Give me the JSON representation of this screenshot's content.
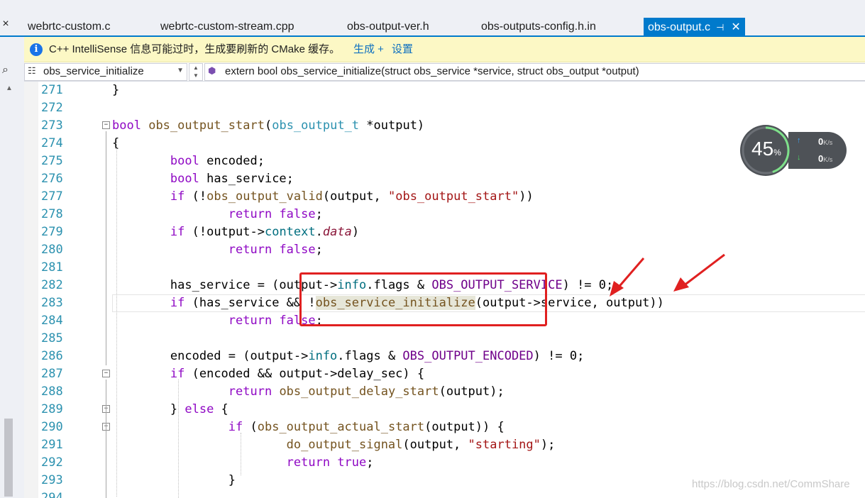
{
  "tabs": {
    "items": [
      {
        "label": "webrtc-custom.c"
      },
      {
        "label": "webrtc-custom-stream.cpp"
      },
      {
        "label": "obs-output-ver.h"
      },
      {
        "label": "obs-outputs-config.h.in"
      },
      {
        "label": "obs-output.c",
        "active": true
      }
    ],
    "close_all": "×",
    "pin_glyph": "⊣",
    "close_glyph": "✕"
  },
  "infobar": {
    "message": "C++ IntelliSense 信息可能过时，生成要刷新的 CMake 缓存。",
    "link_build": "生成 +",
    "link_settings": "设置",
    "icon": "info-icon"
  },
  "navbar": {
    "scope": "obs_service_initialize",
    "member": "extern bool obs_service_initialize(struct obs_service *service, struct obs_output *output)"
  },
  "code": {
    "line_numbers": [
      "271",
      "272",
      "273",
      "274",
      "275",
      "276",
      "277",
      "278",
      "279",
      "280",
      "281",
      "282",
      "283",
      "284",
      "285",
      "286",
      "287",
      "288",
      "289",
      "290",
      "291",
      "292",
      "293",
      "294"
    ]
  },
  "net_widget": {
    "cpu_percent": "45",
    "percent_sign": "%",
    "up_value": "0",
    "down_value": "0",
    "unit": "K/s"
  },
  "watermark": "https://blog.csdn.net/CommShare",
  "colors": {
    "accent": "#007acc",
    "annotation": "#e02020",
    "infobar_bg": "#fcf8c5"
  }
}
